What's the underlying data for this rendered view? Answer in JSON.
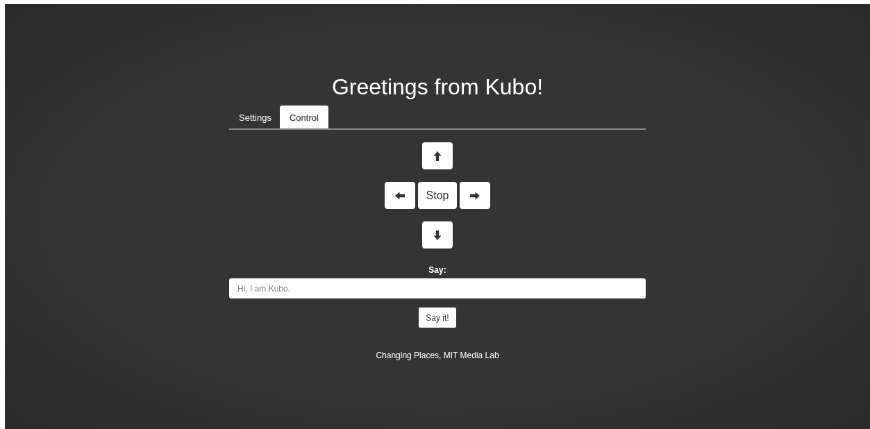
{
  "title": "Greetings from Kubo!",
  "tabs": [
    {
      "label": "Settings",
      "selected": false
    },
    {
      "label": "Control",
      "selected": true
    }
  ],
  "pad": [
    [
      {
        "kind": "up"
      }
    ],
    [
      {
        "kind": "left"
      },
      {
        "kind": "text",
        "label": "Stop"
      },
      {
        "kind": "right"
      }
    ],
    [
      {
        "kind": "down"
      }
    ]
  ],
  "say": {
    "label": "Say:",
    "placeholder": "Hi, I am Kubo.",
    "button": "Say it!"
  },
  "footer": "Changing Places, MIT Media Lab"
}
